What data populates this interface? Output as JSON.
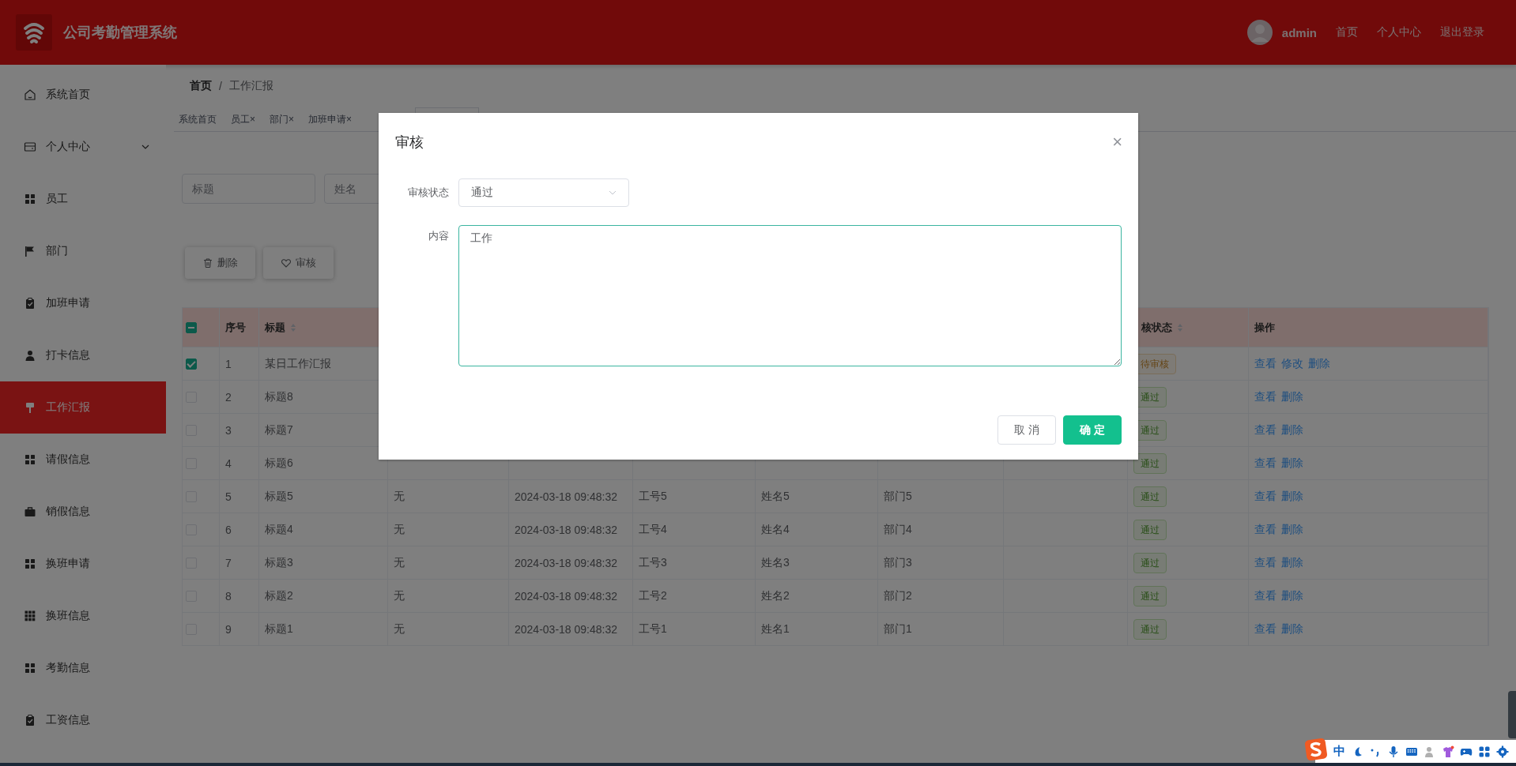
{
  "header": {
    "title": "公司考勤管理系统",
    "user": "admin",
    "links": [
      "首页",
      "个人中心",
      "退出登录"
    ]
  },
  "sidebar": {
    "items": [
      {
        "label": "系统首页",
        "kind": "link",
        "selected": false
      },
      {
        "label": "个人中心",
        "kind": "submenu",
        "expanded": false,
        "selected": false
      },
      {
        "label": "员工",
        "kind": "link",
        "selected": false
      },
      {
        "label": "部门",
        "kind": "link",
        "selected": false
      },
      {
        "label": "加班申请",
        "kind": "link",
        "selected": false
      },
      {
        "label": "打卡信息",
        "kind": "link",
        "selected": false
      },
      {
        "label": "工作汇报",
        "kind": "link",
        "selected": true
      },
      {
        "label": "请假信息",
        "kind": "link",
        "selected": false
      },
      {
        "label": "销假信息",
        "kind": "link",
        "selected": false
      },
      {
        "label": "换班申请",
        "kind": "link",
        "selected": false
      },
      {
        "label": "换班信息",
        "kind": "link",
        "selected": false
      },
      {
        "label": "考勤信息",
        "kind": "link",
        "selected": false
      },
      {
        "label": "工资信息",
        "kind": "link",
        "selected": false
      }
    ]
  },
  "breadcrumb": {
    "separator": "/",
    "items": [
      "首页",
      "工作汇报"
    ]
  },
  "tabs": {
    "close_glyph": "×",
    "items": [
      {
        "label": "系统首页",
        "closable": false,
        "selected": false
      },
      {
        "label": "员工",
        "closable": true,
        "selected": false
      },
      {
        "label": "部门",
        "closable": true,
        "selected": false
      },
      {
        "label": "加班申请",
        "closable": true,
        "selected": false
      },
      {
        "selected": true
      }
    ]
  },
  "search": [
    {
      "placeholder": "标题"
    },
    {
      "placeholder": "姓名"
    }
  ],
  "actions": [
    "删除",
    "审核"
  ],
  "table": {
    "header_checkbox": {
      "indeterminate": true
    },
    "columns": [
      {
        "kind": "check"
      },
      {
        "label": "序号",
        "sortable": false
      },
      {
        "label": "标题",
        "sortable": true
      },
      {},
      {},
      {},
      {},
      {},
      {},
      {
        "label": "核状态",
        "sortable": true
      },
      {
        "label": "操作",
        "sortable": false
      }
    ],
    "rows": [
      {
        "checked": true,
        "index": "1",
        "title": "某日工作汇报",
        "status": {
          "text": "待审核",
          "kind": "pending"
        },
        "actions": [
          "查看",
          "修改",
          "删除"
        ]
      },
      {
        "checked": false,
        "index": "2",
        "title": "标题8",
        "status": {
          "text": "通过",
          "kind": "approved"
        },
        "actions": [
          "查看",
          "删除"
        ]
      },
      {
        "checked": false,
        "index": "3",
        "title": "标题7",
        "status": {
          "text": "通过",
          "kind": "approved"
        },
        "actions": [
          "查看",
          "删除"
        ]
      },
      {
        "checked": false,
        "index": "4",
        "title": "标题6",
        "status": {
          "text": "通过",
          "kind": "approved"
        },
        "actions": [
          "查看",
          "删除"
        ]
      },
      {
        "checked": false,
        "index": "5",
        "title": "标题5",
        "cells": [
          "无",
          "2024-03-18 09:48:32",
          "工号5",
          "姓名5",
          "部门5"
        ],
        "status": {
          "text": "通过",
          "kind": "approved"
        },
        "actions": [
          "查看",
          "删除"
        ]
      },
      {
        "checked": false,
        "index": "6",
        "title": "标题4",
        "cells": [
          "无",
          "2024-03-18 09:48:32",
          "工号4",
          "姓名4",
          "部门4"
        ],
        "status": {
          "text": "通过",
          "kind": "approved"
        },
        "actions": [
          "查看",
          "删除"
        ]
      },
      {
        "checked": false,
        "index": "7",
        "title": "标题3",
        "cells": [
          "无",
          "2024-03-18 09:48:32",
          "工号3",
          "姓名3",
          "部门3"
        ],
        "status": {
          "text": "通过",
          "kind": "approved"
        },
        "actions": [
          "查看",
          "删除"
        ]
      },
      {
        "checked": false,
        "index": "8",
        "title": "标题2",
        "cells": [
          "无",
          "2024-03-18 09:48:32",
          "工号2",
          "姓名2",
          "部门2"
        ],
        "status": {
          "text": "通过",
          "kind": "approved"
        },
        "actions": [
          "查看",
          "删除"
        ]
      },
      {
        "checked": false,
        "index": "9",
        "title": "标题1",
        "cells": [
          "无",
          "2024-03-18 09:48:32",
          "工号1",
          "姓名1",
          "部门1"
        ],
        "status": {
          "text": "通过",
          "kind": "approved"
        },
        "actions": [
          "查看",
          "删除"
        ]
      }
    ]
  },
  "dialog": {
    "title": "审核",
    "close_glyph": "×",
    "fields": [
      {
        "kind": "select",
        "label": "审核状态",
        "value": "通过"
      },
      {
        "kind": "textarea",
        "label": "内容",
        "value": "工作"
      }
    ],
    "buttons": [
      {
        "label": "取 消",
        "kind": "default"
      },
      {
        "label": "确 定",
        "kind": "primary"
      }
    ]
  },
  "ime_toolbar": {
    "mode": "中"
  }
}
